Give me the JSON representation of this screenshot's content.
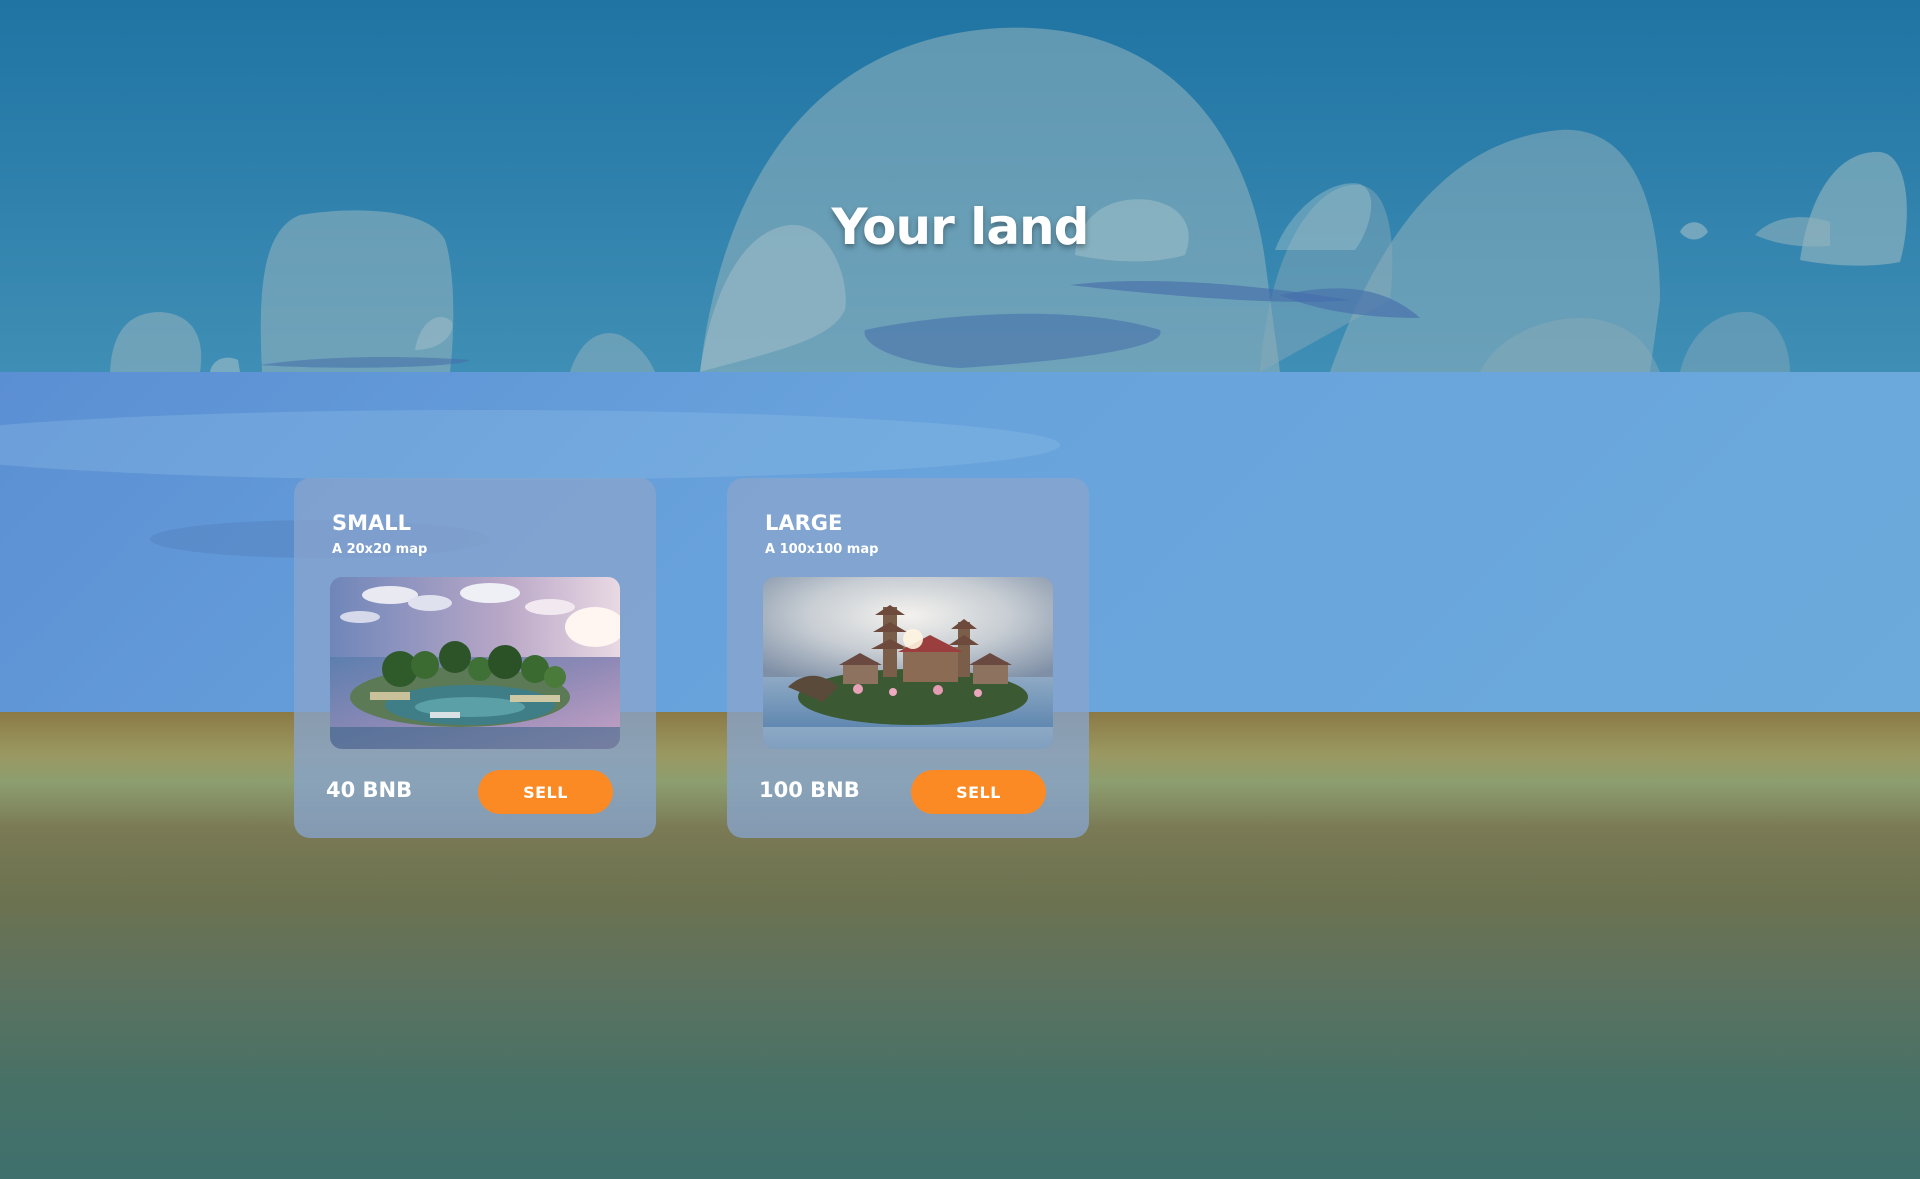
{
  "page": {
    "title": "Your land"
  },
  "lands": [
    {
      "name": "SMALL",
      "description": "A 20x20 map",
      "price": "40 BNB",
      "action_label": "SELL",
      "image": "small-island-thumbnail"
    },
    {
      "name": "LARGE",
      "description": "A 100x100 map",
      "price": "100 BNB",
      "action_label": "SELL",
      "image": "large-island-temple-thumbnail"
    }
  ],
  "colors": {
    "accent": "#fb8a24",
    "card_bg": "#88a4cd",
    "title_text": "#ffffff"
  }
}
